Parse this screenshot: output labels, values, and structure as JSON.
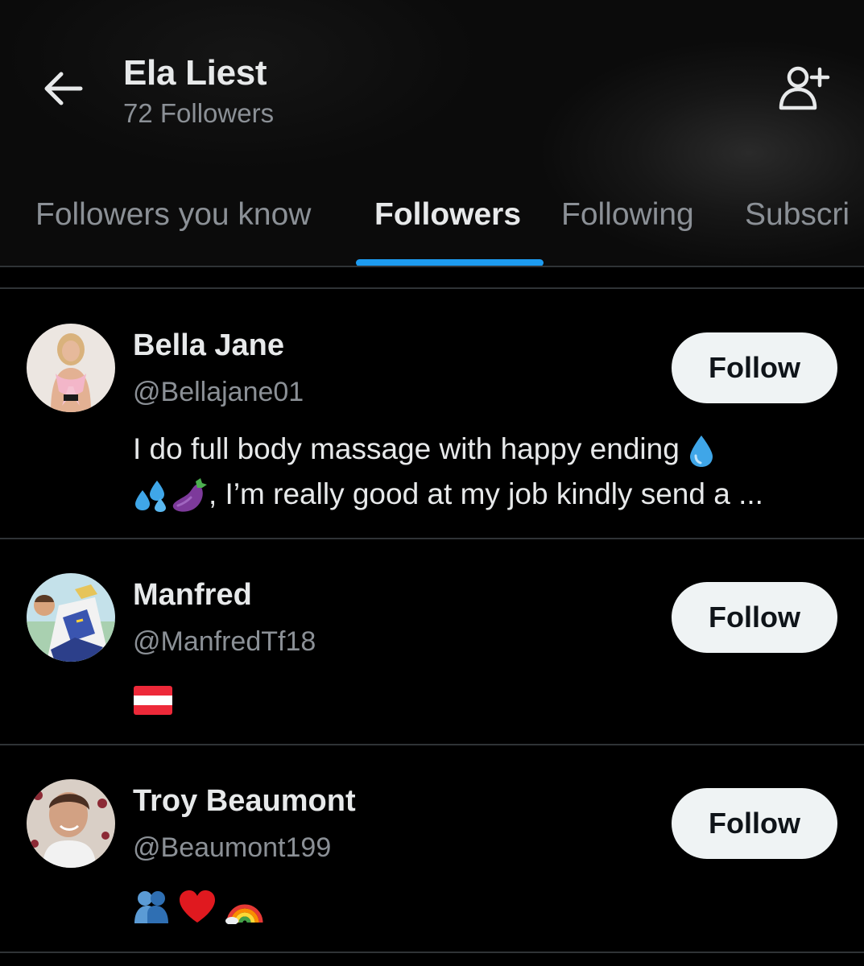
{
  "header": {
    "back_icon": "arrow-left-icon",
    "title": "Ela Liest",
    "subtitle": "72 Followers",
    "add_user_icon": "person-add-icon"
  },
  "tabs": [
    {
      "label": "Followers you know",
      "active": false
    },
    {
      "label": "Followers",
      "active": true
    },
    {
      "label": "Following",
      "active": false
    },
    {
      "label": "Subscri",
      "active": false
    }
  ],
  "accent_color": "#1d9bf0",
  "users": [
    {
      "name": "Bella Jane",
      "handle": "@Bellajane01",
      "bio_line1": "I do full body massage with happy ending",
      "bio_line2": ", I’m really good at my job kindly send a ...",
      "bio_emojis": [
        "droplet",
        "sweat-droplets",
        "eggplant"
      ],
      "follow_label": "Follow"
    },
    {
      "name": "Manfred",
      "handle": "@ManfredTf18",
      "bio_emojis": [
        "flag-austria"
      ],
      "follow_label": "Follow"
    },
    {
      "name": "Troy Beaumont",
      "handle": "@Beaumont199",
      "bio_emojis": [
        "people-hugging",
        "red-heart",
        "rainbow"
      ],
      "follow_label": "Follow"
    }
  ]
}
